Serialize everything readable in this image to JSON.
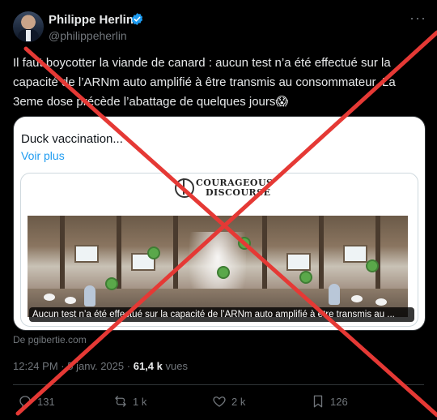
{
  "author": {
    "name": "Philippe Herlin",
    "handle": "@philippeherlin"
  },
  "post": {
    "text": "Il faut boycotter la viande de canard : aucun test n’a été effectué sur la capacité de l’ARNm auto amplifié à être transmis au consommateur. La 3eme dose précède l’abattage de quelques jours😱"
  },
  "card": {
    "title": "Duck vaccination...",
    "more_label": "Voir plus",
    "logo_line1": "COURAGEOUS",
    "logo_line2": "DISCOURSE",
    "image_caption": "Aucun test n’a été effectué sur la capacité de l’ARNm auto amplifié à être transmis au ...",
    "source": "De pgibertie.com"
  },
  "meta": {
    "time": "12:24 PM",
    "separator": "·",
    "date": "5 janv. 2025",
    "views_count": "61,4 k",
    "views_label": "vues"
  },
  "actions": {
    "replies": "131",
    "reposts": "1 k",
    "likes": "2 k",
    "bookmarks": "126"
  },
  "colors": {
    "background": "#000000",
    "text": "#e7e9ea",
    "muted": "#71767b",
    "link": "#1d9bf0",
    "verified": "#1d9bf0",
    "cross": "#e53935"
  },
  "overlay": "red-cross"
}
